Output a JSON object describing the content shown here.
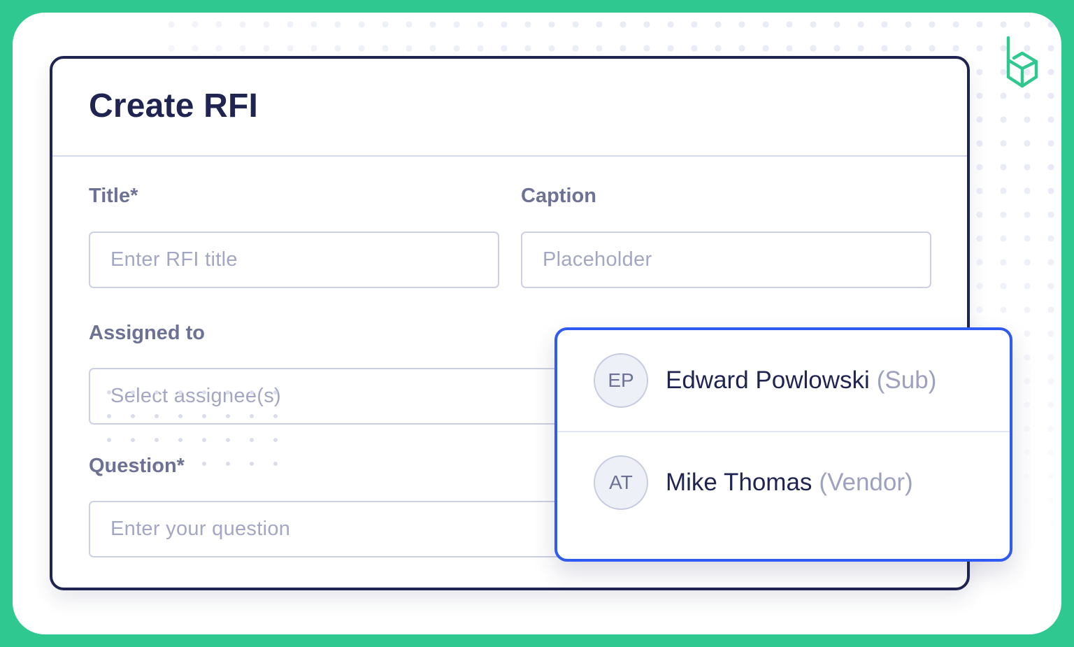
{
  "form": {
    "title": "Create RFI",
    "fields": {
      "title": {
        "label": "Title*",
        "placeholder": "Enter RFI title"
      },
      "caption": {
        "label": "Caption",
        "placeholder": "Placeholder"
      },
      "assigned": {
        "label": "Assigned to",
        "placeholder": "Select assignee(s)"
      },
      "question": {
        "label": "Question*",
        "placeholder": "Enter your question"
      }
    }
  },
  "dropdown": {
    "options": [
      {
        "initials": "EP",
        "name": "Edward Powlowski",
        "role": "(Sub)"
      },
      {
        "initials": "AT",
        "name": "Mike Thomas",
        "role": "(Vendor)"
      }
    ]
  },
  "brand": {
    "logo_icon": "hexagon-b-logo-icon",
    "accent": "#2ec890",
    "dark": "#1f2451",
    "focus": "#2f5bf0"
  }
}
